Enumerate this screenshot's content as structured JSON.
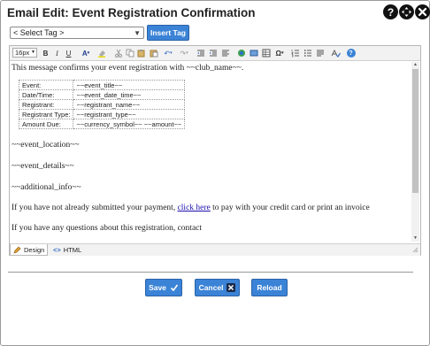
{
  "dialog": {
    "title": "Email Edit: Event Registration Confirmation",
    "help_icon": "question-icon",
    "move_icon": "move-arrows-icon",
    "close_icon": "close-icon"
  },
  "tag_picker": {
    "selected": "< Select Tag >",
    "insert_label": "Insert Tag"
  },
  "toolbar": {
    "font_size": "16px",
    "buttons": [
      "bold",
      "italic",
      "underline",
      "font-color",
      "highlight-color",
      "cut",
      "copy",
      "paste",
      "undo",
      "redo",
      "indent",
      "outdent",
      "image",
      "table",
      "media",
      "special-chars",
      "ordered-list",
      "unordered-list",
      "align",
      "spellcheck",
      "help"
    ]
  },
  "content": {
    "intro": "This message confirms your event registration with ~~club_name~~.",
    "table": [
      {
        "label": "Event:",
        "value": "~~event_title~~"
      },
      {
        "label": "Date/Time:",
        "value": "~~event_date_time~~"
      },
      {
        "label": "Registrant:",
        "value": "~~registrant_name~~"
      },
      {
        "label": "Registrant Type:",
        "value": "~~registrant_type~~"
      },
      {
        "label": "Amount Due:",
        "value": "~~currency_symbol~~ ~~amount~~"
      }
    ],
    "location": "~~event_location~~",
    "details": "~~event_details~~",
    "additional": "~~additional_info~~",
    "payment_before": "If you have not already submitted your payment,",
    "payment_link": "click here",
    "payment_after": "to pay with your credit card or print an invoice",
    "questions": "If you have any questions about this registration, contact"
  },
  "modes": {
    "design": "Design",
    "html": "HTML"
  },
  "actions": {
    "save": "Save",
    "cancel": "Cancel",
    "reload": "Reload"
  },
  "colors": {
    "button_blue": "#3b83d6",
    "link_blue": "#1a0dab"
  }
}
